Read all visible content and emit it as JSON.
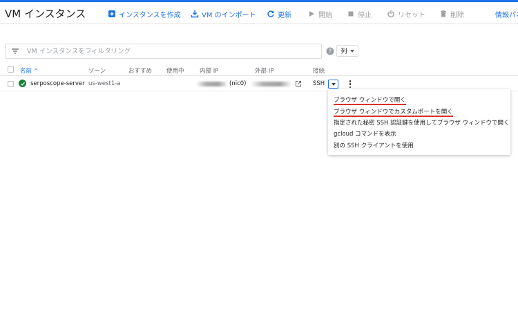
{
  "header": {
    "title": "VM インスタンス",
    "toolbar": {
      "create": "インスタンスを作成",
      "import": "VM のインポート",
      "refresh": "更新",
      "start": "開始",
      "stop": "停止",
      "reset": "リセット",
      "delete": "削除",
      "info": "情報パネ"
    }
  },
  "filter": {
    "placeholder": "VM インスタンスをフィルタリング",
    "columns_label": "列"
  },
  "table": {
    "headers": {
      "name": "名前",
      "zone": "ゾーン",
      "recommend": "おすすめ",
      "in_use": "使用中",
      "internal_ip": "内部 IP",
      "external_ip": "外部 IP",
      "connect": "接続"
    },
    "rows": [
      {
        "name": "serposcope-server",
        "zone": "us-west1-a",
        "internal_ip_suffix": "(nic0)",
        "connect": "SSH"
      }
    ]
  },
  "ssh_menu": {
    "items": [
      "ブラウザ ウィンドウで開く",
      "ブラウザ ウィンドウでカスタムポートを開く",
      "指定された秘密 SSH 認証鍵を使用してブラウザ ウィンドウで開く",
      "gcloud コマンドを表示",
      "別の SSH クライアントを使用"
    ]
  },
  "colors": {
    "accent": "#1a73e8",
    "status_ok": "#188038",
    "underline": "#d93025"
  }
}
